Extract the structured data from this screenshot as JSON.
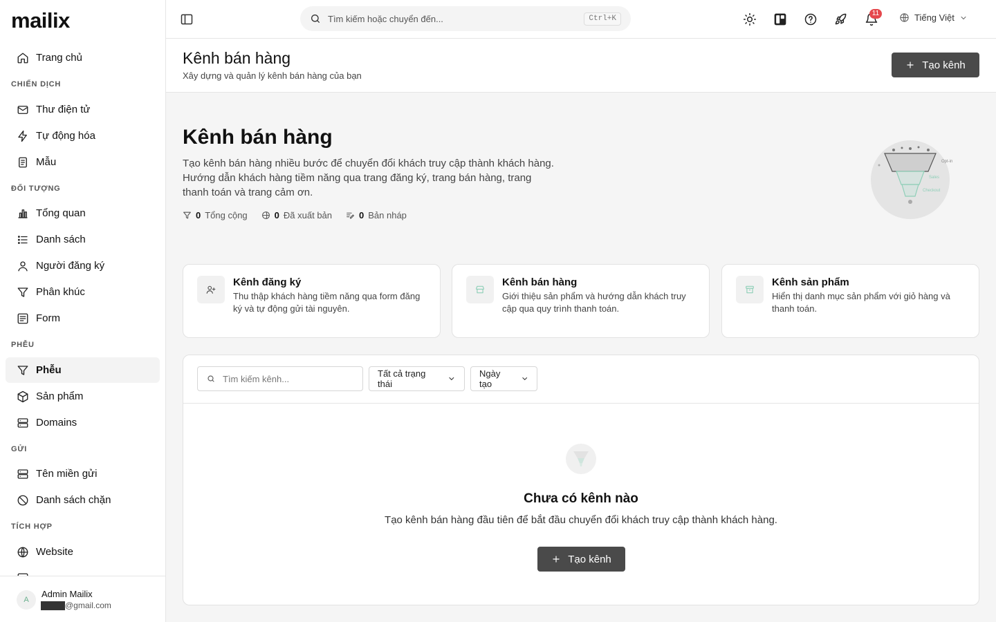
{
  "sidebar": {
    "logo": "mailix",
    "home_label": "Trang chủ",
    "sections": {
      "campaigns": "CHIẾN DỊCH",
      "audience": "ĐỐI TƯỢNG",
      "funnels": "PHỄU",
      "sending": "GỬI",
      "integrations": "TÍCH HỢP"
    },
    "items": {
      "email": "Thư điện tử",
      "automation": "Tự động hóa",
      "templates": "Mẫu",
      "overview": "Tổng quan",
      "lists": "Danh sách",
      "subscribers": "Người đăng ký",
      "segments": "Phân khúc",
      "forms": "Form",
      "funnels": "Phễu",
      "products": "Sản phẩm",
      "domains": "Domains",
      "sending_domains": "Tên miền gửi",
      "blocklist": "Danh sách chặn",
      "website": "Website"
    },
    "active_item": "funnels",
    "user": {
      "avatar_initial": "A",
      "name": "Admin Mailix",
      "email_suffix": "@gmail.com"
    }
  },
  "topbar": {
    "search_placeholder": "Tìm kiếm hoặc chuyển đến...",
    "search_shortcut": "Ctrl+K",
    "notification_count": "11",
    "language": "Tiếng Việt"
  },
  "header": {
    "title": "Kênh bán hàng",
    "subtitle": "Xây dựng và quản lý kênh bán hàng của bạn",
    "create_button": "Tạo kênh"
  },
  "hero": {
    "title": "Kênh bán hàng",
    "description": "Tạo kênh bán hàng nhiều bước để chuyển đổi khách truy cập thành khách hàng. Hướng dẫn khách hàng tiềm năng qua trang đăng ký, trang bán hàng, trang thanh toán và trang cảm ơn.",
    "stats": {
      "total_value": "0",
      "total_label": "Tổng cộng",
      "published_value": "0",
      "published_label": "Đã xuất bản",
      "draft_value": "0",
      "draft_label": "Bản nháp"
    },
    "illustration_labels": {
      "optin": "Opt-in",
      "sales": "Sales",
      "checkout": "Checkout"
    }
  },
  "cards": [
    {
      "title": "Kênh đăng ký",
      "description": "Thu thập khách hàng tiềm năng qua form đăng ký và tự động gửi tài nguyên."
    },
    {
      "title": "Kênh bán hàng",
      "description": "Giới thiệu sản phẩm và hướng dẫn khách truy cập qua quy trình thanh toán."
    },
    {
      "title": "Kênh sản phẩm",
      "description": "Hiển thị danh mục sản phẩm với giỏ hàng và thanh toán."
    }
  ],
  "filters": {
    "search_placeholder": "Tìm kiếm kênh...",
    "status_select": "Tất cả trạng thái",
    "sort_select": "Ngày tạo"
  },
  "empty_state": {
    "title": "Chưa có kênh nào",
    "description": "Tạo kênh bán hàng đầu tiên để bắt đầu chuyển đổi khách truy cập thành khách hàng.",
    "button": "Tạo kênh"
  },
  "colors": {
    "primary_button": "#4a4a4a",
    "badge": "#e5484d",
    "accent_green": "#8fcfb8"
  }
}
